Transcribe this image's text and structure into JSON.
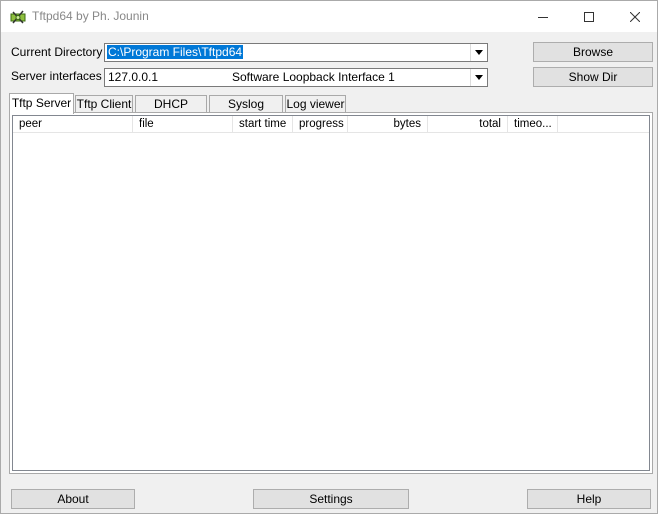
{
  "window": {
    "title": "Tftpd64 by Ph. Jounin"
  },
  "fields": {
    "current_directory_label": "Current Directory",
    "current_directory_value": "C:\\Program Files\\Tftpd64",
    "server_interfaces_label": "Server interfaces",
    "server_interface_ip": "127.0.0.1",
    "server_interface_name": "Software Loopback Interface 1"
  },
  "buttons": {
    "browse": "Browse",
    "show_dir": "Show Dir",
    "about": "About",
    "settings": "Settings",
    "help": "Help"
  },
  "tabs": [
    {
      "label": "Tftp Server",
      "active": true
    },
    {
      "label": "Tftp Client"
    },
    {
      "label": "DHCP server"
    },
    {
      "label": "Syslog server"
    },
    {
      "label": "Log viewer"
    }
  ],
  "table": {
    "columns": [
      "peer",
      "file",
      "start time",
      "progress",
      "bytes",
      "total",
      "timeo..."
    ]
  },
  "icons": [
    "app-icon",
    "minimize-icon",
    "maximize-icon",
    "close-icon",
    "chevron-down-icon"
  ],
  "colors": {
    "selection": "#0078d7",
    "window_bg": "#f0f0f0",
    "title_text": "#888888"
  }
}
